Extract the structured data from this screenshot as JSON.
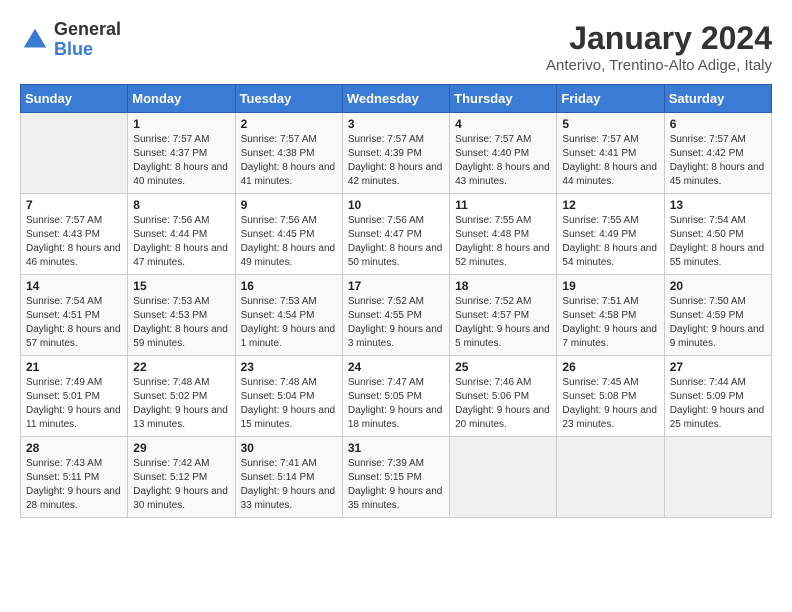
{
  "header": {
    "logo_general": "General",
    "logo_blue": "Blue",
    "month_title": "January 2024",
    "location": "Anterivo, Trentino-Alto Adige, Italy"
  },
  "weekdays": [
    "Sunday",
    "Monday",
    "Tuesday",
    "Wednesday",
    "Thursday",
    "Friday",
    "Saturday"
  ],
  "weeks": [
    [
      {
        "day": "",
        "sunrise": "",
        "sunset": "",
        "daylight": ""
      },
      {
        "day": "1",
        "sunrise": "7:57 AM",
        "sunset": "4:37 PM",
        "daylight": "8 hours and 40 minutes."
      },
      {
        "day": "2",
        "sunrise": "7:57 AM",
        "sunset": "4:38 PM",
        "daylight": "8 hours and 41 minutes."
      },
      {
        "day": "3",
        "sunrise": "7:57 AM",
        "sunset": "4:39 PM",
        "daylight": "8 hours and 42 minutes."
      },
      {
        "day": "4",
        "sunrise": "7:57 AM",
        "sunset": "4:40 PM",
        "daylight": "8 hours and 43 minutes."
      },
      {
        "day": "5",
        "sunrise": "7:57 AM",
        "sunset": "4:41 PM",
        "daylight": "8 hours and 44 minutes."
      },
      {
        "day": "6",
        "sunrise": "7:57 AM",
        "sunset": "4:42 PM",
        "daylight": "8 hours and 45 minutes."
      }
    ],
    [
      {
        "day": "7",
        "sunrise": "7:57 AM",
        "sunset": "4:43 PM",
        "daylight": "8 hours and 46 minutes."
      },
      {
        "day": "8",
        "sunrise": "7:56 AM",
        "sunset": "4:44 PM",
        "daylight": "8 hours and 47 minutes."
      },
      {
        "day": "9",
        "sunrise": "7:56 AM",
        "sunset": "4:45 PM",
        "daylight": "8 hours and 49 minutes."
      },
      {
        "day": "10",
        "sunrise": "7:56 AM",
        "sunset": "4:47 PM",
        "daylight": "8 hours and 50 minutes."
      },
      {
        "day": "11",
        "sunrise": "7:55 AM",
        "sunset": "4:48 PM",
        "daylight": "8 hours and 52 minutes."
      },
      {
        "day": "12",
        "sunrise": "7:55 AM",
        "sunset": "4:49 PM",
        "daylight": "8 hours and 54 minutes."
      },
      {
        "day": "13",
        "sunrise": "7:54 AM",
        "sunset": "4:50 PM",
        "daylight": "8 hours and 55 minutes."
      }
    ],
    [
      {
        "day": "14",
        "sunrise": "7:54 AM",
        "sunset": "4:51 PM",
        "daylight": "8 hours and 57 minutes."
      },
      {
        "day": "15",
        "sunrise": "7:53 AM",
        "sunset": "4:53 PM",
        "daylight": "8 hours and 59 minutes."
      },
      {
        "day": "16",
        "sunrise": "7:53 AM",
        "sunset": "4:54 PM",
        "daylight": "9 hours and 1 minute."
      },
      {
        "day": "17",
        "sunrise": "7:52 AM",
        "sunset": "4:55 PM",
        "daylight": "9 hours and 3 minutes."
      },
      {
        "day": "18",
        "sunrise": "7:52 AM",
        "sunset": "4:57 PM",
        "daylight": "9 hours and 5 minutes."
      },
      {
        "day": "19",
        "sunrise": "7:51 AM",
        "sunset": "4:58 PM",
        "daylight": "9 hours and 7 minutes."
      },
      {
        "day": "20",
        "sunrise": "7:50 AM",
        "sunset": "4:59 PM",
        "daylight": "9 hours and 9 minutes."
      }
    ],
    [
      {
        "day": "21",
        "sunrise": "7:49 AM",
        "sunset": "5:01 PM",
        "daylight": "9 hours and 11 minutes."
      },
      {
        "day": "22",
        "sunrise": "7:48 AM",
        "sunset": "5:02 PM",
        "daylight": "9 hours and 13 minutes."
      },
      {
        "day": "23",
        "sunrise": "7:48 AM",
        "sunset": "5:04 PM",
        "daylight": "9 hours and 15 minutes."
      },
      {
        "day": "24",
        "sunrise": "7:47 AM",
        "sunset": "5:05 PM",
        "daylight": "9 hours and 18 minutes."
      },
      {
        "day": "25",
        "sunrise": "7:46 AM",
        "sunset": "5:06 PM",
        "daylight": "9 hours and 20 minutes."
      },
      {
        "day": "26",
        "sunrise": "7:45 AM",
        "sunset": "5:08 PM",
        "daylight": "9 hours and 23 minutes."
      },
      {
        "day": "27",
        "sunrise": "7:44 AM",
        "sunset": "5:09 PM",
        "daylight": "9 hours and 25 minutes."
      }
    ],
    [
      {
        "day": "28",
        "sunrise": "7:43 AM",
        "sunset": "5:11 PM",
        "daylight": "9 hours and 28 minutes."
      },
      {
        "day": "29",
        "sunrise": "7:42 AM",
        "sunset": "5:12 PM",
        "daylight": "9 hours and 30 minutes."
      },
      {
        "day": "30",
        "sunrise": "7:41 AM",
        "sunset": "5:14 PM",
        "daylight": "9 hours and 33 minutes."
      },
      {
        "day": "31",
        "sunrise": "7:39 AM",
        "sunset": "5:15 PM",
        "daylight": "9 hours and 35 minutes."
      },
      {
        "day": "",
        "sunrise": "",
        "sunset": "",
        "daylight": ""
      },
      {
        "day": "",
        "sunrise": "",
        "sunset": "",
        "daylight": ""
      },
      {
        "day": "",
        "sunrise": "",
        "sunset": "",
        "daylight": ""
      }
    ]
  ],
  "labels": {
    "sunrise_prefix": "Sunrise: ",
    "sunset_prefix": "Sunset: ",
    "daylight_prefix": "Daylight: "
  }
}
